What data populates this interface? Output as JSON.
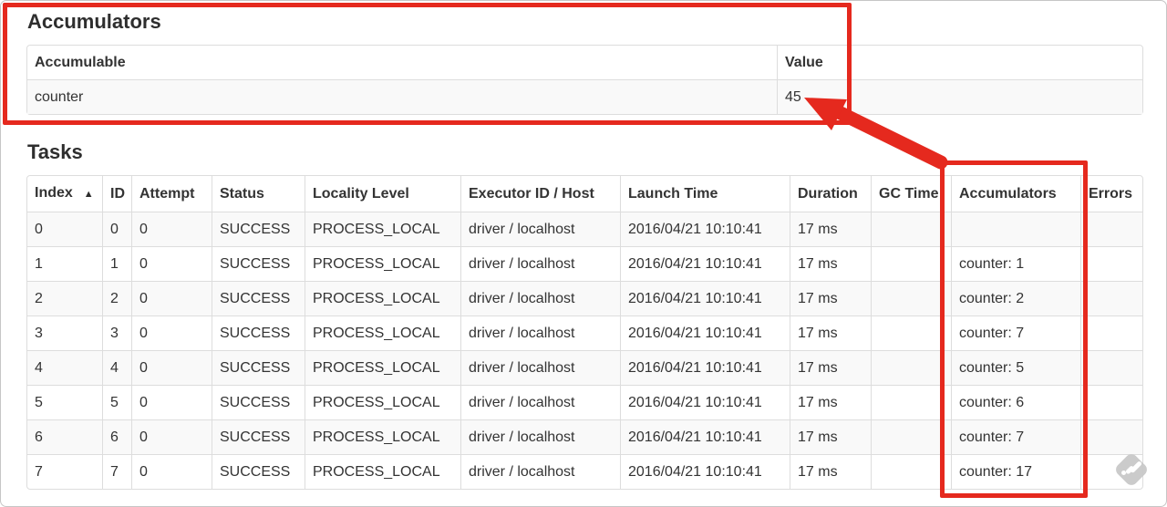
{
  "accumulators": {
    "title": "Accumulators",
    "table": {
      "headers": [
        "Accumulable",
        "Value"
      ],
      "rows": [
        [
          "counter",
          "45"
        ]
      ]
    }
  },
  "tasks": {
    "title": "Tasks",
    "table": {
      "sort_icon": "▲",
      "headers": [
        "Index",
        "ID",
        "Attempt",
        "Status",
        "Locality Level",
        "Executor ID / Host",
        "Launch Time",
        "Duration",
        "GC Time",
        "Accumulators",
        "Errors"
      ],
      "rows": [
        [
          "0",
          "0",
          "0",
          "SUCCESS",
          "PROCESS_LOCAL",
          "driver / localhost",
          "2016/04/21 10:10:41",
          "17 ms",
          "",
          "",
          ""
        ],
        [
          "1",
          "1",
          "0",
          "SUCCESS",
          "PROCESS_LOCAL",
          "driver / localhost",
          "2016/04/21 10:10:41",
          "17 ms",
          "",
          "counter: 1",
          ""
        ],
        [
          "2",
          "2",
          "0",
          "SUCCESS",
          "PROCESS_LOCAL",
          "driver / localhost",
          "2016/04/21 10:10:41",
          "17 ms",
          "",
          "counter: 2",
          ""
        ],
        [
          "3",
          "3",
          "0",
          "SUCCESS",
          "PROCESS_LOCAL",
          "driver / localhost",
          "2016/04/21 10:10:41",
          "17 ms",
          "",
          "counter: 7",
          ""
        ],
        [
          "4",
          "4",
          "0",
          "SUCCESS",
          "PROCESS_LOCAL",
          "driver / localhost",
          "2016/04/21 10:10:41",
          "17 ms",
          "",
          "counter: 5",
          ""
        ],
        [
          "5",
          "5",
          "0",
          "SUCCESS",
          "PROCESS_LOCAL",
          "driver / localhost",
          "2016/04/21 10:10:41",
          "17 ms",
          "",
          "counter: 6",
          ""
        ],
        [
          "6",
          "6",
          "0",
          "SUCCESS",
          "PROCESS_LOCAL",
          "driver / localhost",
          "2016/04/21 10:10:41",
          "17 ms",
          "",
          "counter: 7",
          ""
        ],
        [
          "7",
          "7",
          "0",
          "SUCCESS",
          "PROCESS_LOCAL",
          "driver / localhost",
          "2016/04/21 10:10:41",
          "17 ms",
          "",
          "counter: 17",
          ""
        ]
      ]
    }
  },
  "annotations": {
    "color": "#e5291e",
    "box1_target": "accumulators-summary-table",
    "box2_target": "tasks-accumulators-column",
    "arrow_points_to": "45"
  },
  "watermark_icon": "diamond-watermark"
}
